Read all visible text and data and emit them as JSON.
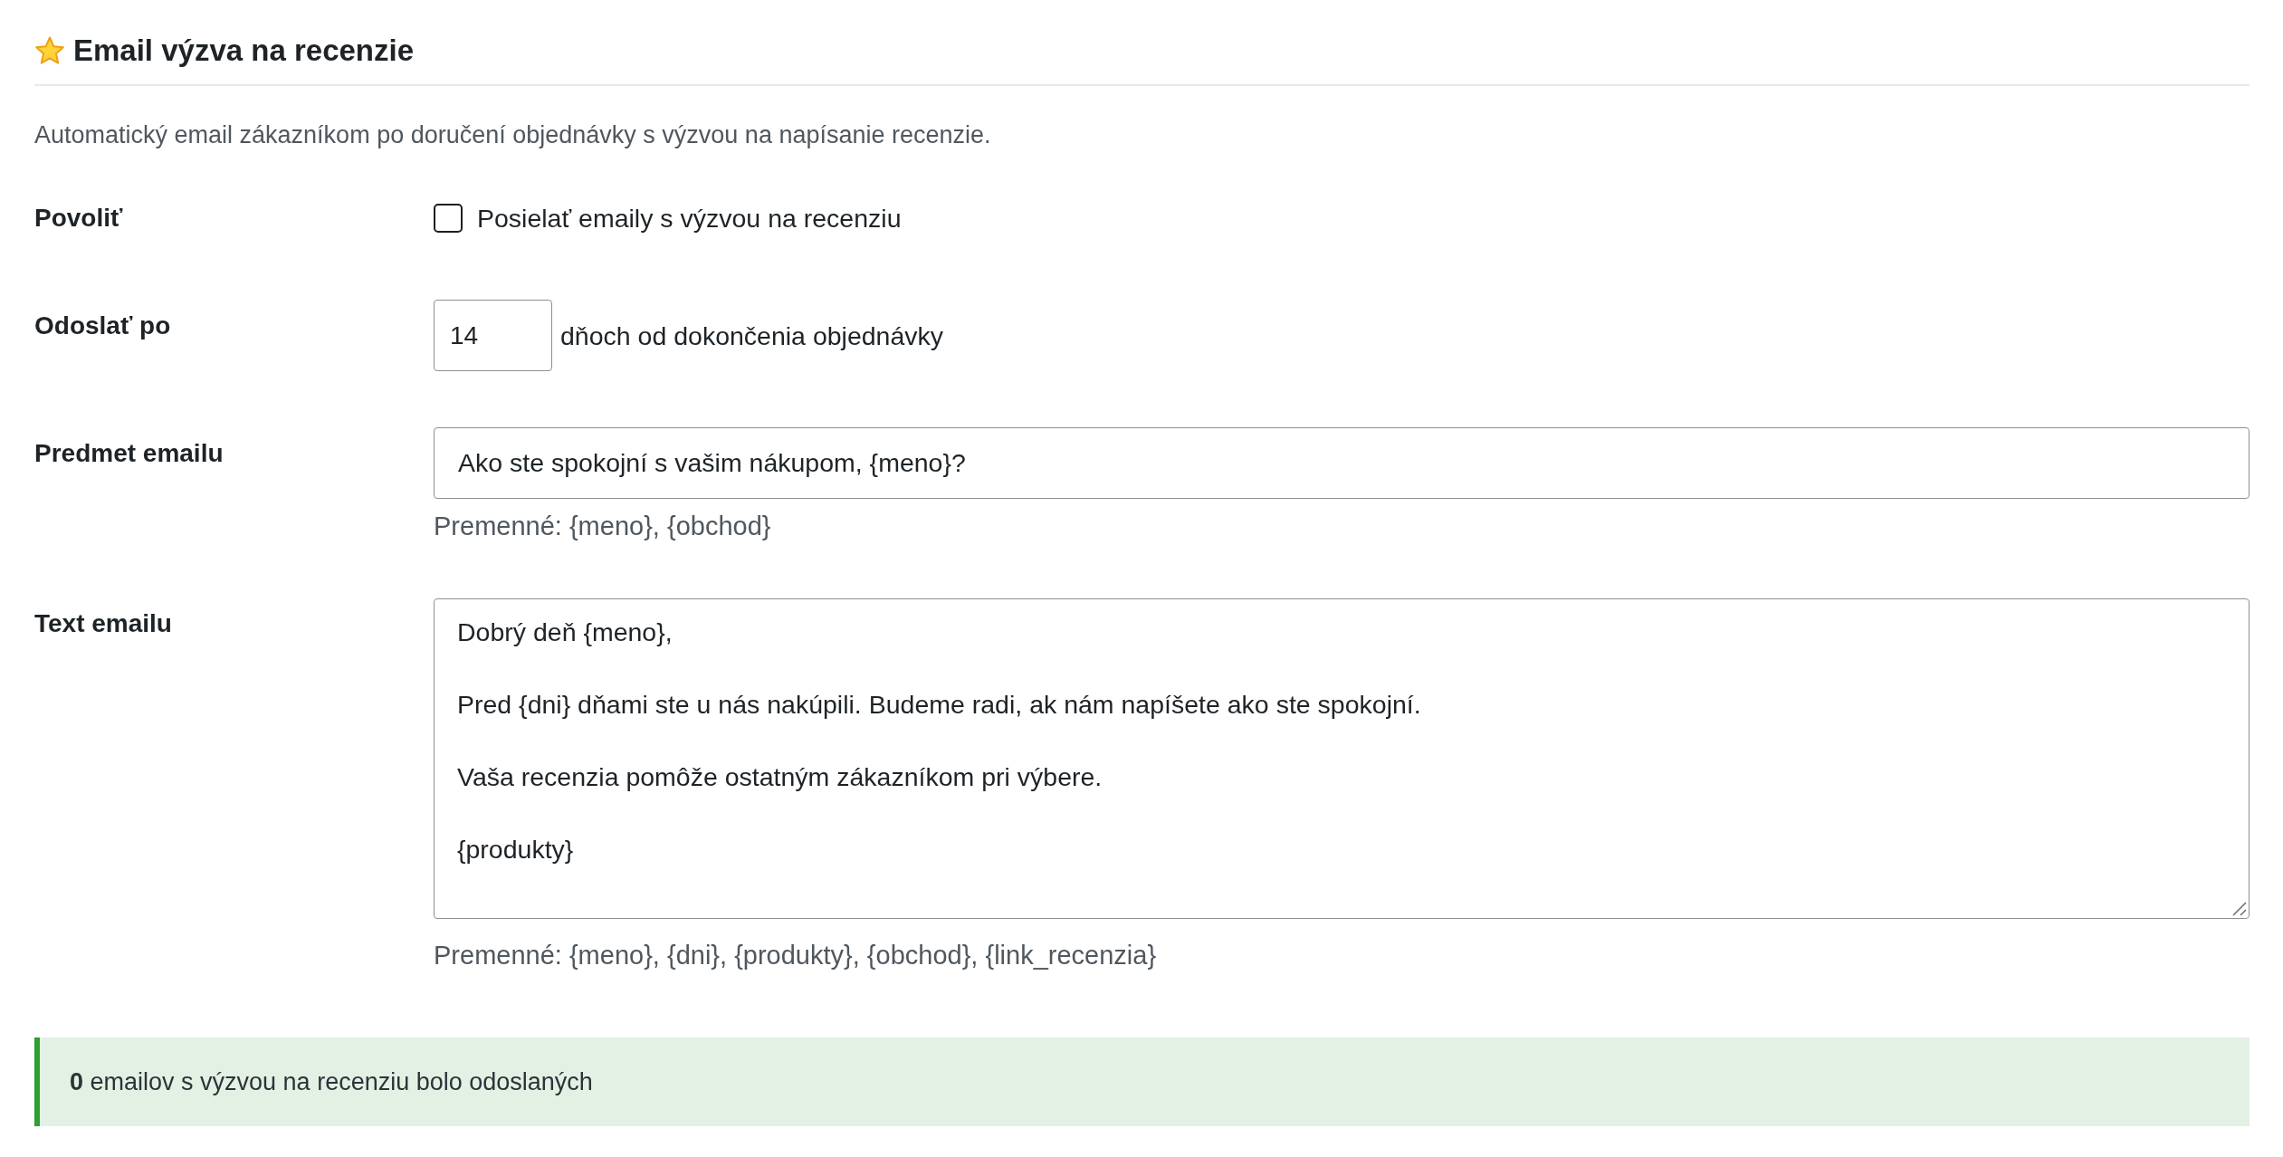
{
  "section": {
    "title": "Email výzva na recenzie",
    "description": "Automatický email zákazníkom po doručení objednávky s výzvou na napísanie recenzie."
  },
  "settings": [
    {
      "kind": "checkbox",
      "label": "Povoliť",
      "option": "Posielať emaily s výzvou na recenziu",
      "checked": false
    },
    {
      "kind": "number",
      "label": "Odoslať po",
      "value": "14",
      "suffix": "dňoch od dokončenia objednávky"
    },
    {
      "kind": "text",
      "label": "Predmet emailu",
      "value": "Ako ste spokojní s vašim nákupom, {meno}?",
      "hint": "Premenné: {meno}, {obchod}"
    },
    {
      "kind": "textarea",
      "label": "Text emailu",
      "paragraphs": [
        "Dobrý deň {meno},",
        "Pred {dni} dňami ste u nás nakúpili. Budeme radi, ak nám napíšete ako ste spokojní.",
        "Vaša recenzia pomôže ostatným zákazníkom pri výbere.",
        "{produkty}"
      ],
      "hint": "Premenné: {meno}, {dni}, {produkty}, {obchod}, {link_recenzia}"
    }
  ],
  "notice": {
    "text": "**0** emailov s výzvou na recenziu bolo odoslaných"
  }
}
